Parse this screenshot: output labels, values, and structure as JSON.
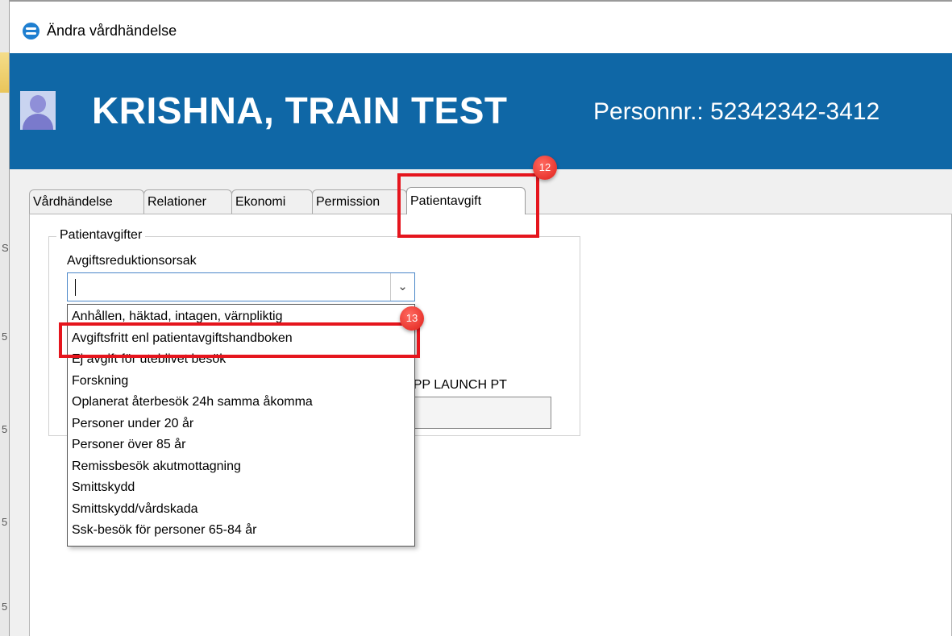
{
  "window": {
    "title": "Ändra vårdhändelse"
  },
  "patient": {
    "name": "KRISHNA, TRAIN TEST",
    "personnr_label": "Personnr.:",
    "personnr_value": "52342342-3412"
  },
  "tabs": [
    {
      "label": "Vårdhändelse",
      "active": false
    },
    {
      "label": "Relationer",
      "active": false
    },
    {
      "label": "Ekonomi",
      "active": false
    },
    {
      "label": "Permission",
      "active": false
    },
    {
      "label": "Patientavgift",
      "active": true
    }
  ],
  "patientavgift": {
    "group_label": "Patientavgifter",
    "reason_label": "Avgiftsreduktionsorsak",
    "reason_value": "",
    "second_field_label": "T APP LAUNCH PT",
    "dropdown_options": [
      "Anhållen, häktad, intagen, värnpliktig",
      "Avgiftsfritt enl patientavgiftshandboken",
      "Ej avgift för uteblivet besök",
      "Forskning",
      "Oplanerat återbesök 24h samma åkomma",
      "Personer under 20 år",
      "Personer över 85 år",
      "Remissbesök akutmottagning",
      "Smittskydd",
      "Smittskydd/vårdskada",
      "Ssk-besök för personer 65-84 år"
    ]
  },
  "annotations": {
    "step_tab": "12",
    "step_option": "13",
    "highlight_color": "#e5151d"
  },
  "colors": {
    "banner": "#0f67a6",
    "combo_border": "#4a86c8"
  },
  "icons": {
    "title": "app-logo-icon",
    "patient": "patient-avatar-icon",
    "combo": "chevron-down-icon"
  }
}
